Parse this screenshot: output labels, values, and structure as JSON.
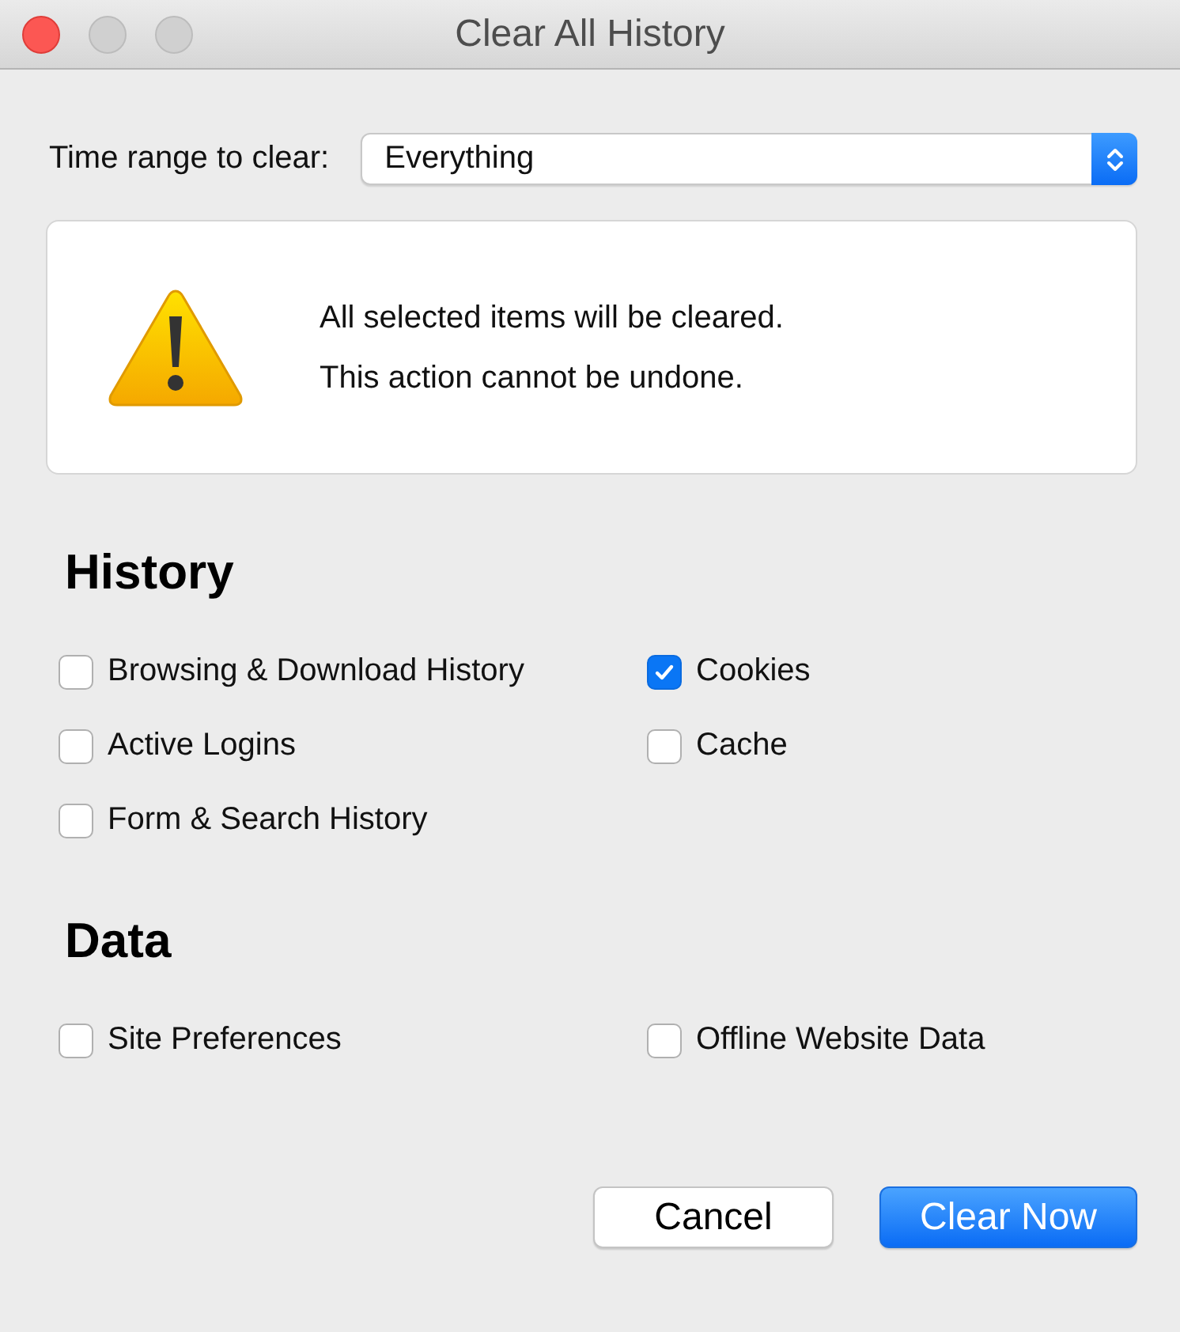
{
  "window": {
    "title": "Clear All History"
  },
  "time_range": {
    "label": "Time range to clear:",
    "value": "Everything"
  },
  "warning": {
    "lines": [
      "All selected items will be cleared.",
      "This action cannot be undone."
    ]
  },
  "sections": [
    {
      "title": "History",
      "items": [
        {
          "label": "Browsing & Download History",
          "checked": false
        },
        {
          "label": "Cookies",
          "checked": true
        },
        {
          "label": "Active Logins",
          "checked": false
        },
        {
          "label": "Cache",
          "checked": false
        },
        {
          "label": "Form & Search History",
          "checked": false
        }
      ]
    },
    {
      "title": "Data",
      "items": [
        {
          "label": "Site Preferences",
          "checked": false
        },
        {
          "label": "Offline Website Data",
          "checked": false
        }
      ]
    }
  ],
  "buttons": [
    {
      "label": "Cancel",
      "kind": "secondary"
    },
    {
      "label": "Clear Now",
      "kind": "primary"
    }
  ]
}
